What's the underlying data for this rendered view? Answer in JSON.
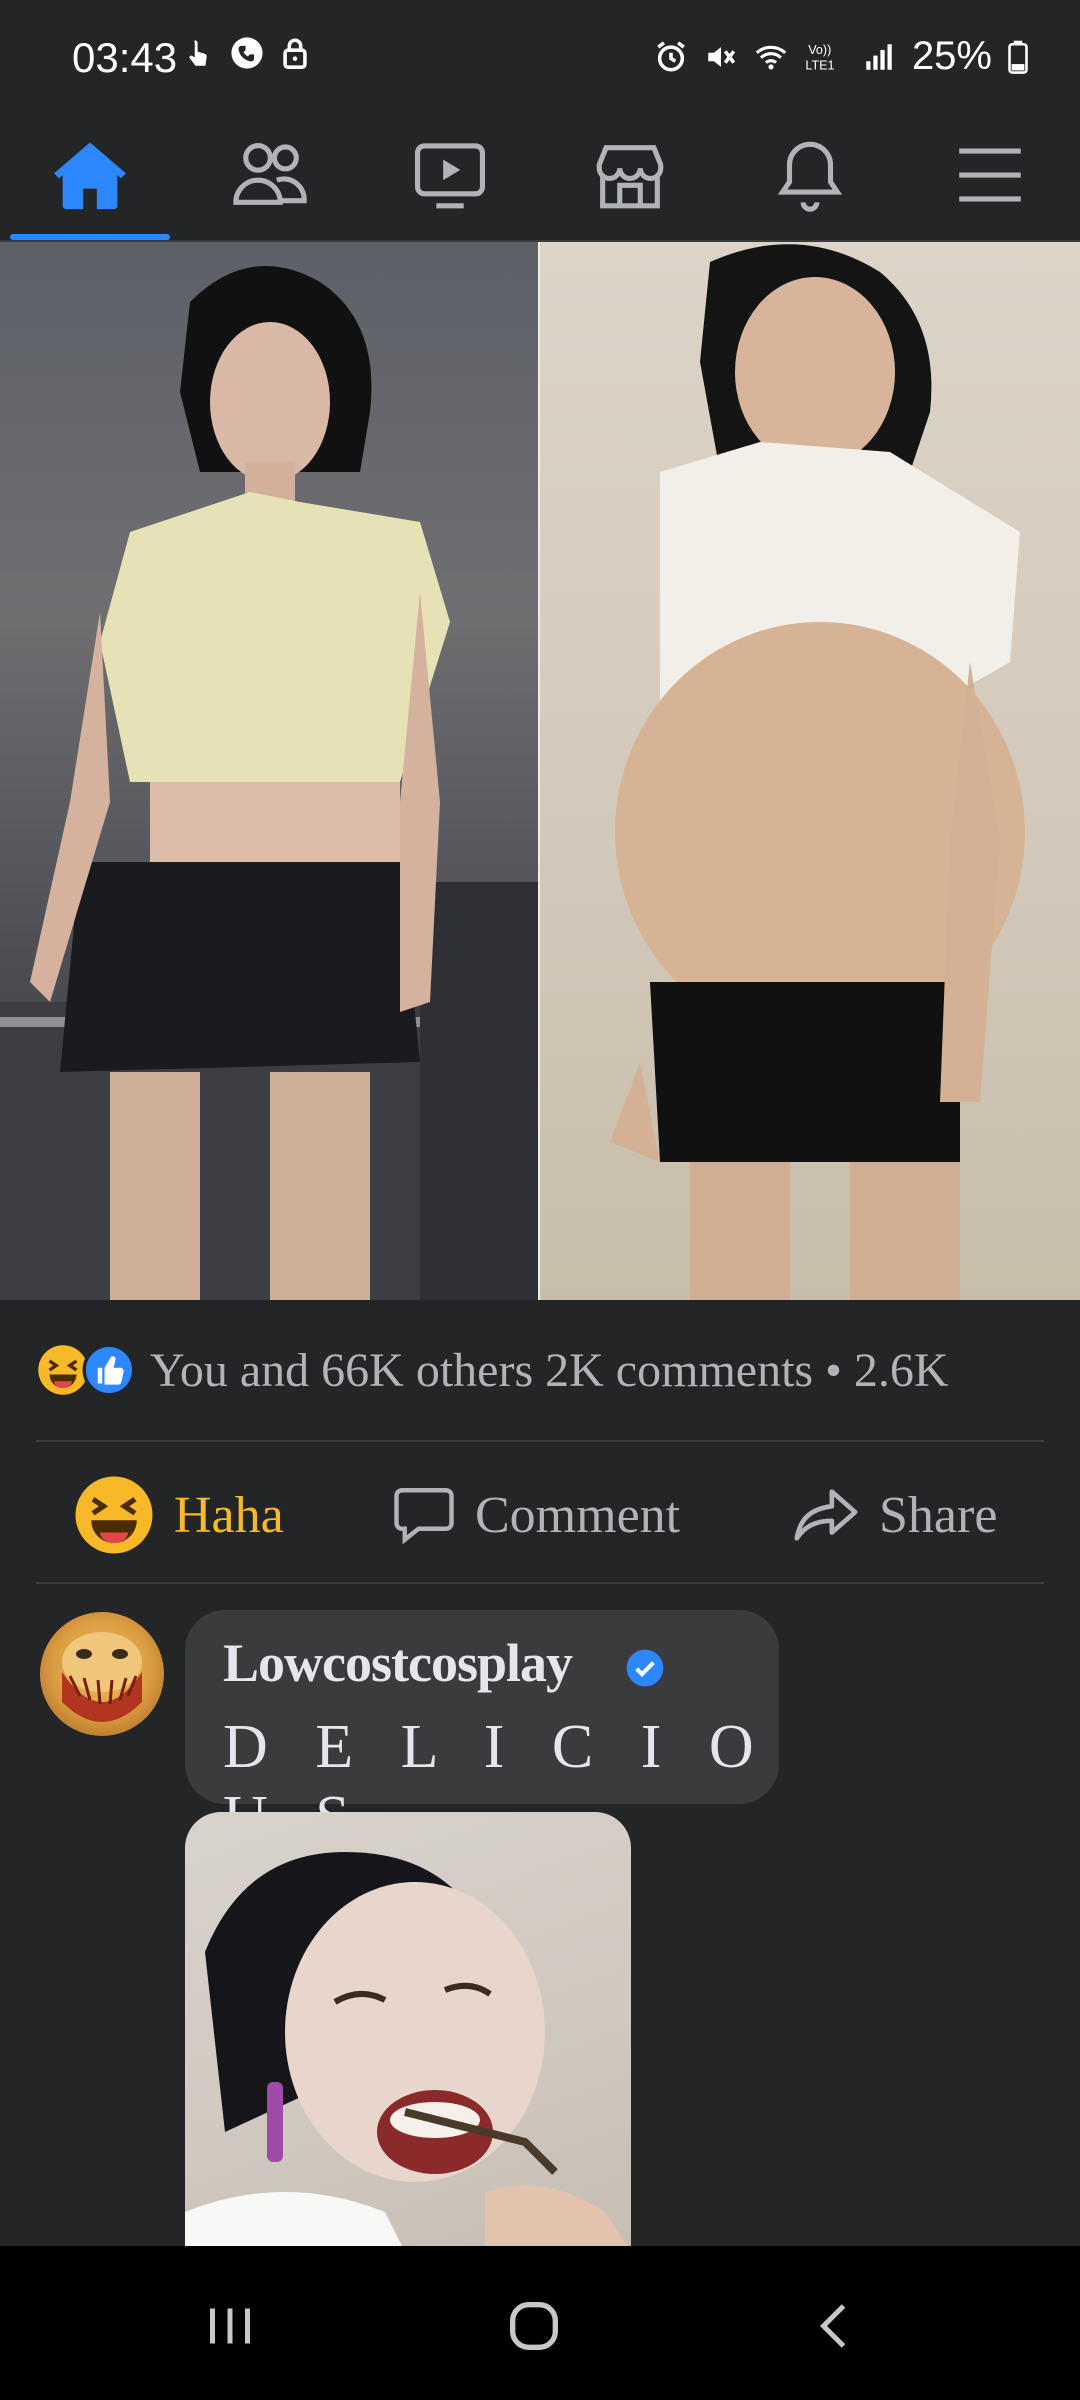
{
  "status_bar": {
    "time": "03:43",
    "battery": "25%",
    "icons_left": [
      "touch-icon",
      "shield-phone-icon",
      "lock-icon"
    ],
    "icons_right": [
      "alarm-icon",
      "mute-icon",
      "wifi-icon",
      "volte-icon",
      "signal-icon",
      "battery-icon"
    ]
  },
  "nav": {
    "items": [
      {
        "name": "home",
        "icon": "home-icon",
        "active": true
      },
      {
        "name": "friends",
        "icon": "friends-icon"
      },
      {
        "name": "watch",
        "icon": "video-icon"
      },
      {
        "name": "marketplace",
        "icon": "store-icon"
      },
      {
        "name": "notifications",
        "icon": "bell-icon"
      },
      {
        "name": "menu",
        "icon": "hamburger-icon"
      }
    ],
    "accent": "#2d88ff"
  },
  "post": {
    "reactions_summary": "You and 66K others 2K comments • 2.6K"
  },
  "actions": {
    "haha_label": "Haha",
    "comment_label": "Comment",
    "share_label": "Share",
    "haha_color": "#f7b928"
  },
  "comment": {
    "author": "Lowcostcosplay",
    "verified": true,
    "text": "D E L I C I O U S"
  },
  "system_nav": {
    "items": [
      "recents-icon",
      "home-circle-icon",
      "back-icon"
    ]
  }
}
